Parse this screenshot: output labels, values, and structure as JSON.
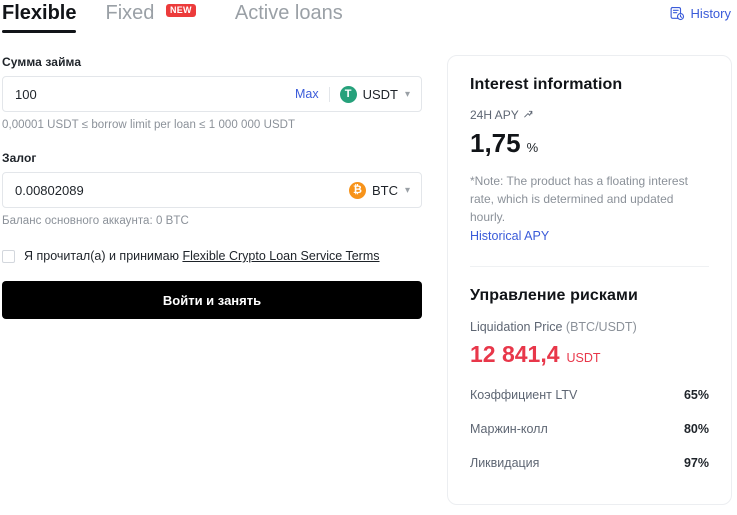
{
  "tabs": [
    {
      "label": "Flexible",
      "active": true,
      "badge": null
    },
    {
      "label": "Fixed",
      "active": false,
      "badge": "NEW"
    },
    {
      "label": "Active loans",
      "active": false,
      "badge": null
    }
  ],
  "header": {
    "history_label": "History",
    "history_icon": "history-document-icon"
  },
  "loan": {
    "label": "Сумма займа",
    "value": "100",
    "placeholder": "",
    "max_label": "Max",
    "coin_symbol": "USDT",
    "coin_glyph": "T",
    "coin_color": "#26a17b",
    "helper": "0,00001 USDT ≤ borrow limit per loan ≤ 1 000 000 USDT"
  },
  "collateral": {
    "label": "Залог",
    "value": "0.00802089",
    "placeholder": "",
    "coin_symbol": "BTC",
    "coin_glyph": "₿",
    "coin_color": "#f7931a",
    "helper": "Баланс основного аккаунта: 0 BTC"
  },
  "terms": {
    "prefix": "Я прочитал(а) и принимаю",
    "link_label": "Flexible Crypto Loan Service Terms",
    "checked": false
  },
  "submit": {
    "label": "Войти и занять"
  },
  "interest": {
    "title": "Interest information",
    "apy_label": "24H APY",
    "apy_icon": "trend-up-icon",
    "apy_value": "1,75",
    "apy_unit": "%",
    "note": "*Note: The product has a floating interest rate, which is determined and updated hourly.",
    "historical_link": "Historical APY"
  },
  "risk": {
    "title": "Управление рисками",
    "liquidation_price_label": "Liquidation Price",
    "liquidation_price_pair": "(BTC/USDT)",
    "liquidation_price_value": "12 841,4",
    "liquidation_price_currency": "USDT",
    "liquidation_price_color": "#e8374a",
    "rows": [
      {
        "key": "Коэффициент LTV",
        "value": "65%"
      },
      {
        "key": "Маржин-колл",
        "value": "80%"
      },
      {
        "key": "Ликвидация",
        "value": "97%"
      }
    ]
  },
  "colors": {
    "accent_blue": "#3a5bd9",
    "danger_red": "#e8374a",
    "badge_red": "#ec3b3b",
    "black": "#000000"
  }
}
